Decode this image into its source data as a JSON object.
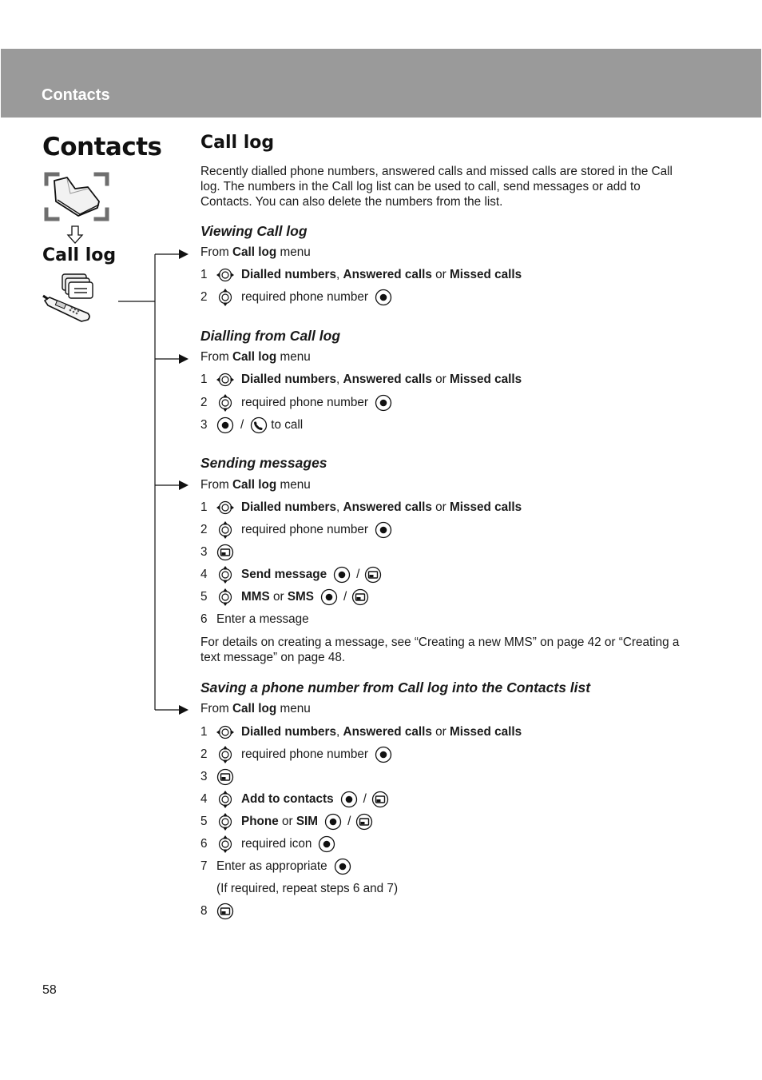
{
  "header": {
    "title": "Contacts"
  },
  "sidebar": {
    "title": "Contacts",
    "subtitle": "Call log"
  },
  "main": {
    "title": "Call log",
    "intro": "Recently dialled phone numbers, answered calls and missed calls are stored in the Call log. The numbers in the Call log list can be used to call, send messages or add to Contacts. You can also delete the numbers from the list.",
    "from_prefix": "From",
    "from_bold": "Call log",
    "from_suffix": "menu",
    "opt_dialled": "Dialled numbers",
    "comma": ",",
    "opt_answered": "Answered calls",
    "or": "or",
    "opt_missed": "Missed calls",
    "required_phone": "required phone number",
    "slash": "/",
    "sections": [
      {
        "heading": "Viewing Call log"
      },
      {
        "heading": "Dialling from Call log",
        "to_call": "to call"
      },
      {
        "heading": "Sending messages",
        "send_message": "Send message",
        "mms": "MMS",
        "sms": "SMS",
        "enter_message": "Enter a message",
        "note": "For details on creating a message, see “Creating a new MMS” on page 42 or “Creating a text message” on page 48."
      },
      {
        "heading": "Saving a phone number from Call log into the Contacts list",
        "add_to_contacts": "Add to contacts",
        "phone": "Phone",
        "sim": "SIM",
        "required_icon": "required icon",
        "enter_appropriate": "Enter as appropriate",
        "repeat_note": "(If required, repeat steps 6 and 7)"
      }
    ],
    "step_numbers": [
      "1",
      "2",
      "3",
      "4",
      "5",
      "6",
      "7",
      "8"
    ]
  },
  "footer": {
    "page_number": "58"
  },
  "icons": {
    "lr": "left-right-navigation-key",
    "ud": "up-down-navigation-key",
    "ok": "centre-select-key",
    "soft": "soft-key",
    "call": "call-key"
  }
}
